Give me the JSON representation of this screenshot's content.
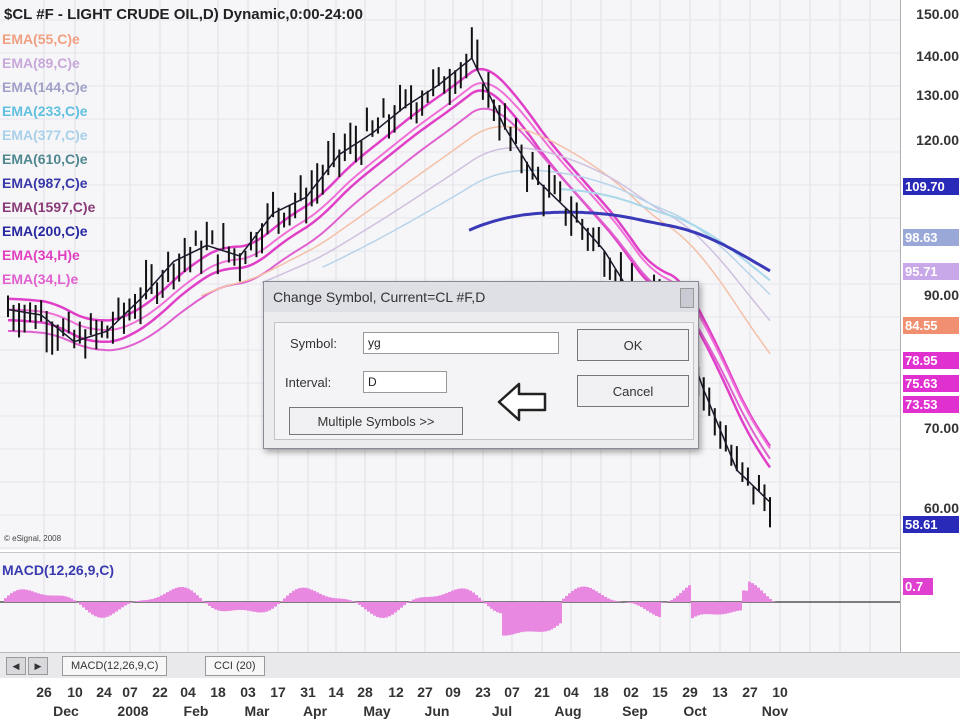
{
  "chart": {
    "title": "$CL #F - LIGHT CRUDE OIL,D) Dynamic,0:00-24:00",
    "copyright": "© eSignal, 2008",
    "ma_labels": [
      {
        "text": "EMA(55,C)e",
        "color": "#f0a080"
      },
      {
        "text": "EMA(89,C)e",
        "color": "#c8a8d8"
      },
      {
        "text": "EMA(144,C)e",
        "color": "#a0a0c8"
      },
      {
        "text": "EMA(233,C)e",
        "color": "#60c0e0"
      },
      {
        "text": "EMA(377,C)e",
        "color": "#a8d0e8"
      },
      {
        "text": "EMA(610,C)e",
        "color": "#508890"
      },
      {
        "text": "EMA(987,C)e",
        "color": "#3838a8"
      },
      {
        "text": "EMA(1597,C)e",
        "color": "#8a3a78"
      },
      {
        "text": "EMA(200,C)e",
        "color": "#2828a0"
      },
      {
        "text": "EMA(34,H)e",
        "color": "#e040c0"
      },
      {
        "text": "EMA(34,L)e",
        "color": "#e060d0"
      }
    ],
    "price_ticks": [
      "150.00",
      "140.00",
      "130.00",
      "120.00",
      "90.00",
      "70.00",
      "60.00"
    ],
    "price_badges": [
      {
        "text": "109.70",
        "color": "#2a2ab8"
      },
      {
        "text": "98.63",
        "color": "#9aa8d8"
      },
      {
        "text": "95.71",
        "color": "#c8a8e8"
      },
      {
        "text": "84.55",
        "color": "#f09070"
      },
      {
        "text": "78.95",
        "color": "#e030d0"
      },
      {
        "text": "75.63",
        "color": "#e030d0"
      },
      {
        "text": "73.53",
        "color": "#e030d0"
      },
      {
        "text": "58.61",
        "color": "#2a2ab8"
      }
    ],
    "macd_label": "MACD(12,26,9,C)",
    "macd_badge": {
      "text": "0.7",
      "color": "#e040d0"
    },
    "accent_pink": "#e040c8",
    "accent_blue": "#2a2ab8",
    "chart_data": {
      "type": "line",
      "x": [
        "2007-12-26",
        "2008-01-10",
        "2008-01-24",
        "2008-02-07",
        "2008-02-22",
        "2008-03-05",
        "2008-03-19",
        "2008-04-02",
        "2008-04-16",
        "2008-04-30",
        "2008-05-14",
        "2008-05-28",
        "2008-06-11",
        "2008-06-25",
        "2008-07-09",
        "2008-07-23",
        "2008-08-06",
        "2008-08-20",
        "2008-09-03",
        "2008-09-17",
        "2008-10-01",
        "2008-10-15",
        "2008-10-29",
        "2008-11-07"
      ],
      "series": [
        {
          "name": "$CL #F",
          "values": [
            96,
            95,
            90,
            92,
            98,
            105,
            108,
            106,
            114,
            117,
            125,
            129,
            134,
            138,
            143,
            130,
            120,
            114,
            107,
            97,
            98,
            81,
            66,
            60
          ]
        }
      ],
      "ylim": [
        52,
        152
      ]
    },
    "date_axis": {
      "days": [
        {
          "d": "26",
          "x": 44
        },
        {
          "d": "10",
          "x": 75
        },
        {
          "d": "24",
          "x": 104
        },
        {
          "d": "07",
          "x": 130
        },
        {
          "d": "22",
          "x": 160
        },
        {
          "d": "04",
          "x": 188
        },
        {
          "d": "18",
          "x": 218
        },
        {
          "d": "03",
          "x": 248
        },
        {
          "d": "17",
          "x": 278
        },
        {
          "d": "31",
          "x": 308
        },
        {
          "d": "14",
          "x": 336
        },
        {
          "d": "28",
          "x": 365
        },
        {
          "d": "12",
          "x": 396
        },
        {
          "d": "27",
          "x": 425
        },
        {
          "d": "09",
          "x": 453
        },
        {
          "d": "23",
          "x": 483
        },
        {
          "d": "07",
          "x": 512
        },
        {
          "d": "21",
          "x": 542
        },
        {
          "d": "04",
          "x": 571
        },
        {
          "d": "18",
          "x": 601
        },
        {
          "d": "02",
          "x": 631
        },
        {
          "d": "15",
          "x": 660
        },
        {
          "d": "29",
          "x": 690
        },
        {
          "d": "13",
          "x": 720
        },
        {
          "d": "27",
          "x": 750
        },
        {
          "d": "10",
          "x": 780
        }
      ],
      "months": [
        {
          "m": "Dec",
          "x": 66
        },
        {
          "m": "2008",
          "x": 133
        },
        {
          "m": "Feb",
          "x": 196
        },
        {
          "m": "Mar",
          "x": 257
        },
        {
          "m": "Apr",
          "x": 315
        },
        {
          "m": "May",
          "x": 377
        },
        {
          "m": "Jun",
          "x": 437
        },
        {
          "m": "Jul",
          "x": 502
        },
        {
          "m": "Aug",
          "x": 568
        },
        {
          "m": "Sep",
          "x": 635
        },
        {
          "m": "Oct",
          "x": 695
        },
        {
          "m": "Nov",
          "x": 775
        }
      ]
    }
  },
  "tabs": {
    "macd": "MACD(12,26,9,C)",
    "cci": "CCI (20)"
  },
  "dialog": {
    "title": "Change Symbol, Current=CL #F,D",
    "symbol_label": "Symbol:",
    "symbol_value": "yg",
    "interval_label": "Interval:",
    "interval_value": "D",
    "multiple_button": "Multiple Symbols >>",
    "ok_button": "OK",
    "cancel_button": "Cancel"
  }
}
